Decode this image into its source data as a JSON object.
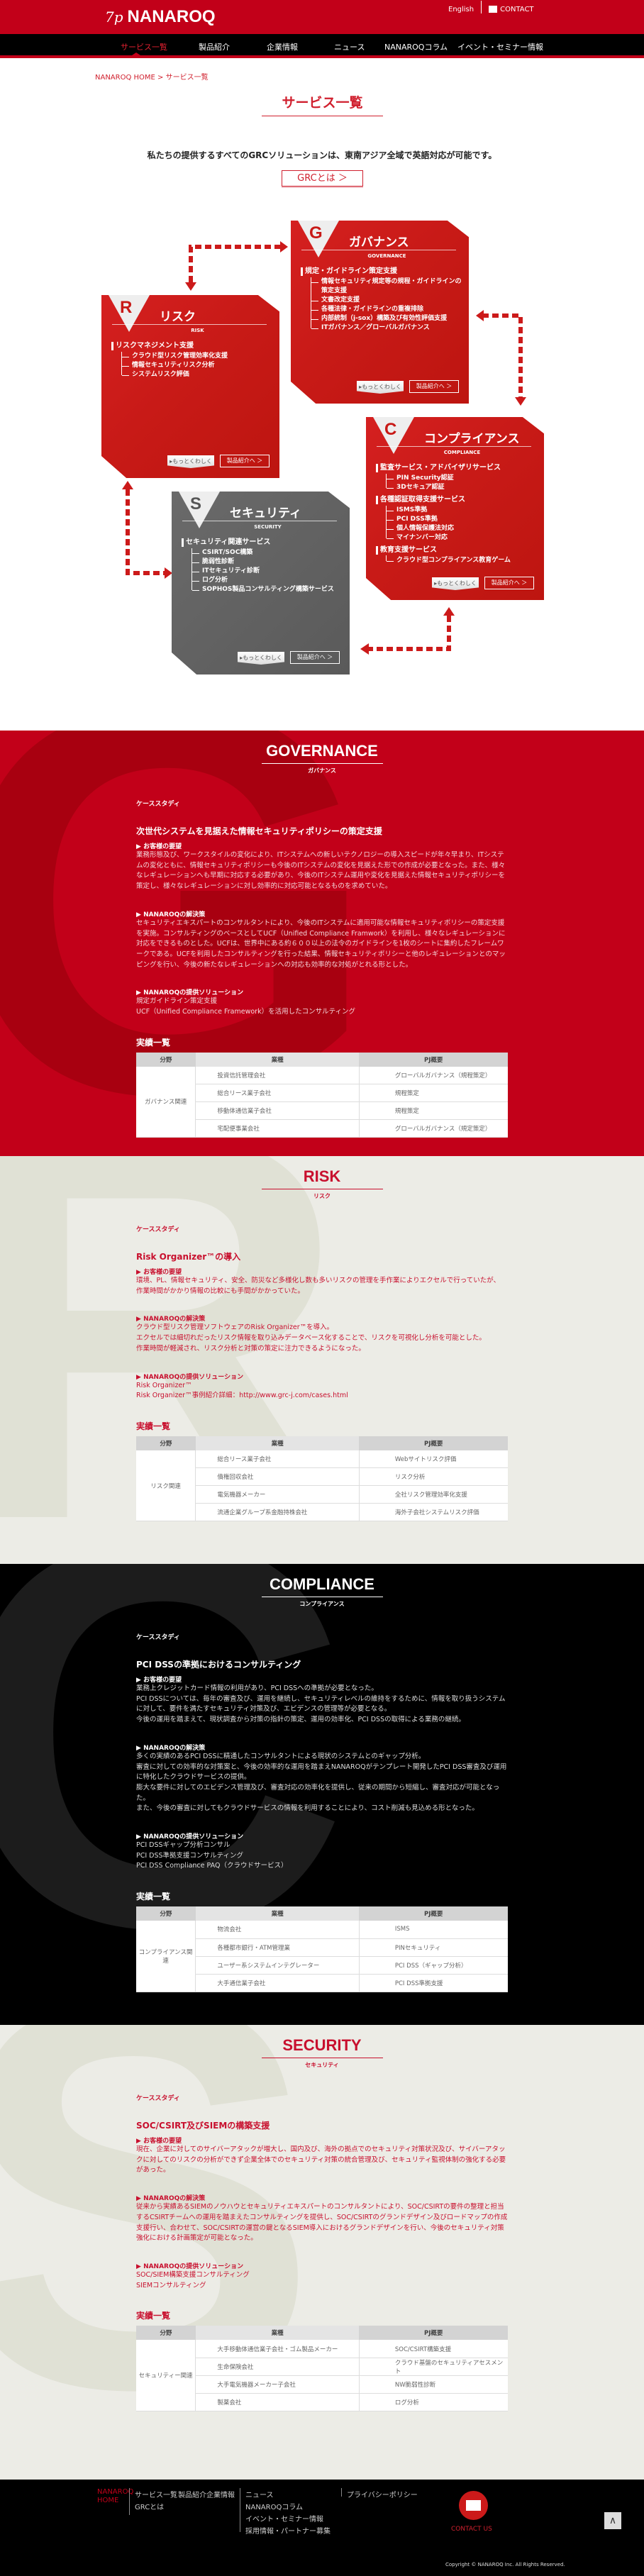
{
  "colors": {
    "brand": "#c20019",
    "box_red": "#c81a17",
    "box_gray": "#626262",
    "light_bg": "#ececE6"
  },
  "header": {
    "logo_mark": "7p",
    "logo": "NANAROQ",
    "english": "English",
    "contact": "CONTACT"
  },
  "nav": {
    "items": [
      "サービス一覧",
      "製品紹介",
      "企業情報",
      "ニュース",
      "NANAROQコラム",
      "イベント・セミナー情報"
    ]
  },
  "breadcrumb": {
    "home": "NANAROQ HOME",
    "sep": " > ",
    "current": "サービス一覧"
  },
  "page_title": "サービス一覧",
  "intro": "私たちの提供するすべてのGRCソリューションは、東南アジア全域で英語対応が可能です。",
  "grc_button": "GRCとは ＞",
  "diagram": {
    "boxes": [
      {
        "letter": "G",
        "title": "ガバナンス",
        "subtitle": "GOVERNANCE",
        "groups": [
          {
            "heading": "規定・ガイドライン策定支援",
            "items": [
              "情報セキュリティ規定等の規程・ガイドラインの策定支援",
              "文書改定支援",
              "各種法律・ガイドラインの重複排除",
              "内部統制（j-sox）構築及び有効性評価支援",
              "ITガバナンス／グローバルガバナンス"
            ]
          }
        ],
        "more": "▸もっとくわしく",
        "product": "製品紹介へ ＞"
      },
      {
        "letter": "R",
        "title": "リスク",
        "subtitle": "RISK",
        "groups": [
          {
            "heading": "リスクマネジメント支援",
            "items": [
              "クラウド型リスク管理効率化支援",
              "情報セキュリティリスク分析",
              "システムリスク評価"
            ]
          }
        ],
        "more": "▸もっとくわしく",
        "product": "製品紹介へ ＞"
      },
      {
        "letter": "C",
        "title": "コンプライアンス",
        "subtitle": "COMPLIANCE",
        "groups": [
          {
            "heading": "監査サービス・アドバイザリサービス",
            "items": [
              "PIN Security認証",
              "3Dセキュア認証"
            ]
          },
          {
            "heading": "各種認証取得支援サービス",
            "items": [
              "ISMS準拠",
              "PCI DSS準拠",
              "個人情報保護法対応",
              "マイナンバー対応"
            ]
          },
          {
            "heading": "教育支援サービス",
            "items": [
              "クラウド型コンプライアンス教育ゲーム"
            ]
          }
        ],
        "more": "▸もっとくわしく",
        "product": "製品紹介へ ＞"
      },
      {
        "letter": "S",
        "title": "セキュリティ",
        "subtitle": "SECURITY",
        "groups": [
          {
            "heading": "セキュリティ関連サービス",
            "items": [
              "CSIRT/SOC構築",
              "脆弱性診断",
              "ITセキュリティ診断",
              "ログ分析",
              "SOPHOS製品コンサルティング構築サービス"
            ]
          }
        ],
        "more": "▸もっとくわしく",
        "product": "製品紹介へ ＞"
      }
    ]
  },
  "sections": [
    {
      "id": "gov",
      "bg_letter": "G",
      "title": "GOVERNANCE",
      "subtitle": "ガバナンス",
      "case_label": "ケーススタディ",
      "case_title": "次世代システムを見据えた情報セキュリティポリシーの策定支援",
      "needs_label": "お客様の要望",
      "needs": [
        "業務形態及び、ワークスタイルの変化により、ITシステムへの新しいテクノロジーの導入スピードが年々早まり、ITシステムの変化ともに、情報セキュリティポリシーも今後のITシステムの変化を見据えた形での作成が必要となった。また、様々なレギュレーションへも早期に対応する必要があり、今後のITシステム運用や変化を見据えた情報セキュリティポリシーを策定し、様々なレギュレーションに対し効率的に対応可能となるものを求めていた。"
      ],
      "solution_label": "NANAROQの解決策",
      "solution": [
        "セキュリティエキスパートのコンサルタントにより、今後のITシステムに適用可能な情報セキュリティポリシーの策定支援を実施。コンサルティングのベースとしてUCF（Unified Compliance Framwork）を利用し、様々なレギュレーションに対応をできるものとした。UCFは、世界中にある約６００以上の法令のガイドラインを1枚のシートに集約したフレームワークである。UCFを利用したコンサルティングを行った結果、情報セキュリティポリシーと他のレギュレーションとのマッピングを行い、今後の新たなレギュレーションへの対応も効率的な対処がとれる形とした。"
      ],
      "offer_label": "NANAROQの提供ソリューション",
      "offer": [
        "規定ガイドライン策定支援",
        "UCF（Unified Compliance Framework）を活用したコンサルティング"
      ],
      "results_label": "実績一覧",
      "table": {
        "headers": [
          "分野",
          "業種",
          "PJ概要"
        ],
        "category": "ガバナンス関連",
        "rows": [
          [
            "投資信託管理会社",
            "グローバルガバナンス（規程策定）"
          ],
          [
            "総合リース業子会社",
            "規程策定"
          ],
          [
            "移動体通信業子会社",
            "規程策定"
          ],
          [
            "宅配便事業会社",
            "グローバルガバナンス（規定策定）"
          ]
        ]
      }
    },
    {
      "id": "risk",
      "bg_letter": "R",
      "title": "RISK",
      "subtitle": "リスク",
      "case_label": "ケーススタディ",
      "case_title": "Risk Organizer™の導入",
      "needs_label": "お客様の要望",
      "needs": [
        "環境、PL、情報セキュリティ、安全、防災など多様化し数も多いリスクの管理を手作業によりエクセルで行っていたが、",
        "作業時間がかかり情報の比較にも手間がかかっていた。"
      ],
      "solution_label": "NANAROQの解決策",
      "solution": [
        "クラウド型リスク管理ソフトウェアのRisk Organizer™を導入。",
        "エクセルでは細切れだったリスク情報を取り込みデータベース化することで、リスクを可視化し分析を可能とした。",
        "作業時間が軽減され、リスク分析と対策の策定に注力できるようになった。"
      ],
      "offer_label": "NANAROQの提供ソリューション",
      "offer": [
        "Risk Organizer™",
        "Risk Organizer™事例紹介詳細：http://www.grc-j.com/cases.html"
      ],
      "results_label": "実績一覧",
      "table": {
        "headers": [
          "分野",
          "業種",
          "PJ概要"
        ],
        "category": "リスク関連",
        "rows": [
          [
            "総合リース業子会社",
            "Webサイトリスク評価"
          ],
          [
            "債権回収会社",
            "リスク分析"
          ],
          [
            "電気機器メーカー",
            "全社リスク管理効率化支援"
          ],
          [
            "流通企業グループ系金融持株会社",
            "海外子会社システムリスク評価"
          ]
        ]
      }
    },
    {
      "id": "comp",
      "bg_letter": "C",
      "title": "COMPLIANCE",
      "subtitle": "コンプライアンス",
      "case_label": "ケーススタディ",
      "case_title": "PCI DSSの準拠におけるコンサルティング",
      "needs_label": "お客様の要望",
      "needs": [
        "業務上クレジットカード情報の利用があり、PCI DSSへの準拠が必要となった。",
        "PCI DSSについては、毎年の審査及び、運用を継続し、セキュリティレベルの維持をするために、情報を取り扱うシステムに対して、要件を満たすセキュリティ対策及び、エビデンスの管理等が必要となる。",
        "今後の運用を踏まえて、現状調査から対策の指針の策定、運用の効率化、PCI DSSの取得による業務の継続。"
      ],
      "solution_label": "NANAROQの解決策",
      "solution": [
        "多くの実績のあるPCI DSSに精通したコンサルタントによる現状のシステムとのギャップ分析。",
        "審査に対しての効率的な対策案と、今後の効率的な運用を踏まえNANAROQがテンプレート開発したPCI DSS審査及び運用に特化したクラウドサービスの提供。",
        "膨大な要件に対してのエビデンス管理及び、審査対応の効率化を提供し、従来の期間から短縮し、審査対応が可能となった。",
        "また、今後の審査に対してもクラウドサービスの情報を利用することにより、コスト削減も見込める形となった。"
      ],
      "offer_label": "NANAROQの提供ソリューション",
      "offer": [
        "PCI DSSギャップ分析コンサル",
        "PCI DSS準拠支援コンサルティング",
        "PCI DSS Compliance PAQ（クラウドサービス）"
      ],
      "results_label": "実績一覧",
      "table": {
        "headers": [
          "分野",
          "業種",
          "PJ概要"
        ],
        "category": "コンプライアンス関連",
        "rows": [
          [
            "物流会社",
            "ISMS"
          ],
          [
            "各種都市銀行・ATM管理業",
            "PINセキュリティ"
          ],
          [
            "ユーザー系システムインテグレーター",
            "PCI DSS（ギャップ分析）"
          ],
          [
            "大手通信業子会社",
            "PCI DSS準拠支援"
          ]
        ]
      }
    },
    {
      "id": "sec",
      "bg_letter": "S",
      "title": "SECURITY",
      "subtitle": "セキュリティ",
      "case_label": "ケーススタディ",
      "case_title": "SOC/CSIRT及びSIEMの構築支援",
      "needs_label": "お客様の要望",
      "needs": [
        "現在、企業に対してのサイバーアタックが増大し、国内及び、海外の拠点でのセキュリティ対策状況及び、サイバーアタックに対してのリスクの分析ができず企業全体でのセキュリティ対策の統合管理及び、セキュリティ監視体制の強化する必要があった。"
      ],
      "solution_label": "NANAROQの解決策",
      "solution": [
        "従来から実績あるSIEMのノウハウとセキュリティエキスパートのコンサルタントにより、SOC/CSIRTの要件の整理と担当するCSIRTチームへの運用を踏まえたコンサルティングを提供し、SOC/CSIRTのグランドデザイン及びロードマップの作成支援行い、合わせて、SOC/CSIRTの運営の鍵となるSIEM導入におけるグランドデザインを行い、今後のセキュリティ対策強化における計画策定が可能となった。"
      ],
      "offer_label": "NANAROQの提供ソリューション",
      "offer": [
        "SOC/SIEM構築支援コンサルティング",
        "SIEMコンサルティング"
      ],
      "results_label": "実績一覧",
      "table": {
        "headers": [
          "分野",
          "業種",
          "PJ概要"
        ],
        "category": "セキュリティー関連",
        "rows": [
          [
            "大手移動体通信業子会社・ゴム製品メーカー",
            "SOC/CSIRT構築支援"
          ],
          [
            "生命保険会社",
            "クラウド基盤のセキュリティアセスメント"
          ],
          [
            "大手電気機器メーカー子会社",
            "NW脆弱性診断"
          ],
          [
            "製薬会社",
            "ログ分析"
          ]
        ]
      }
    }
  ],
  "footer": {
    "home": "NANAROQ HOME",
    "col1": [
      "サービス一覧",
      "製品紹介",
      "企業情報",
      "GRCとは"
    ],
    "col2": [
      "ニュース",
      "NANAROQコラム",
      "イベント・セミナー情報",
      "採用情報・パートナー募集"
    ],
    "privacy": "プライバシーポリシー",
    "contact": "CONTACT US",
    "to_top": "∧",
    "copyright": "Copyright © NANAROQ Inc. All Rights Reserved."
  }
}
